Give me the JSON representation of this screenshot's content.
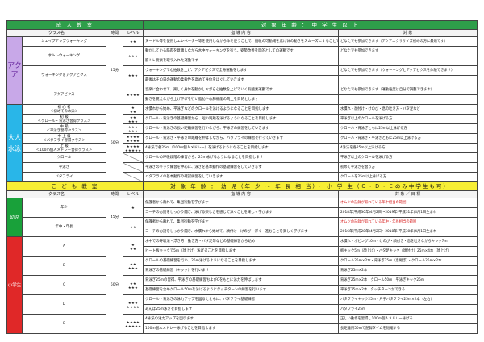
{
  "adult": {
    "title": "成 人 教 室",
    "age_banner": "対 象 年 齢 ： 中 学 生 以 上",
    "headers": {
      "class": "クラス名",
      "time": "時間",
      "level": "レベル",
      "guidance": "指 導 内 容",
      "target": "対 象"
    },
    "aqua": {
      "category": "アクア",
      "time": "45分",
      "rows": [
        {
          "name": "シェイプアップウォーキング",
          "level": "★★",
          "guidance": "ヌードル等を使用しエレベーター等を使用しながら体を使うことで、鋭敏の可動域を広げ体の動きをスムーズにすることでVO2Peakアップを目指すクラス",
          "target": "どなたでも参加できます（アクアエクササイズ初めの方に最適です）"
        },
        {
          "name": "水トレウォーキング",
          "level": "★★★",
          "guidance": "動かしている筋肉を意識しながら水中ウォーキングを行う。姿勢改善を目的としての運動です",
          "target": "どなたでも参加できます"
        },
        {
          "name": "",
          "level": "",
          "guidance": "筋トレ要素を取り入れた運動です",
          "target": ""
        },
        {
          "name": "ウォーキング＆アクアビクス",
          "level": "★★★",
          "guidance": "ウォーキングで心拍数を上げ、アクアビクスで全身運動をします",
          "target": "どなたでも参加できます（ウォーキングとアクアビクスを体験できます）"
        },
        {
          "name": "",
          "level": "",
          "guidance": "最後はその日の運動の柔軟性を高めて身体をほぐしていきます",
          "target": ""
        },
        {
          "name": "アクアビクス",
          "level": "★★★★",
          "guidance": "音楽に合わせて、楽しく身体を動かしながら心拍数を上げていく有酸素運動です",
          "target": "どなたでも参加できます（運動強度は自分で調整できます）"
        },
        {
          "name": "",
          "level": "",
          "guidance": "動きを覚えながら上げ下げを行い脂肪や心肺機能の向上を目的とします",
          "target": ""
        }
      ]
    },
    "swim": {
      "category": "大人水泳",
      "time": "60分",
      "rows": [
        {
          "name": "初 心 者",
          "name2": "＜初めての水泳＞",
          "level": "★\n★★",
          "guidance": "水慣れから始め、平泳ぎなどのクロールを泳げるようになることを目指します",
          "target": "水慣れ・顔付け・けのび・息の吐き方・バタ足など"
        },
        {
          "name": "初 級",
          "name2": "＜クロール・背泳ぎ習得クラス＞",
          "level": "★★\n★★★",
          "guidance": "クロール・背泳ぎの基礎練習から、短い距離を泳げるようになることを目指します",
          "target": "平泳ぎ以上のクロールを泳げる方"
        },
        {
          "name": "中 級",
          "name2": "＜平泳ぎ習得クラス＞",
          "level": "★★★\n★★★",
          "guidance": "クロール・背泳ぎの長い距離練習を行いながら、平泳ぎの練習をしていきます",
          "target": "クロール・背泳ぎともに25m以上泳げる方"
        },
        {
          "name": "中 上 級",
          "name2": "＜バタフライ習得クラス＞",
          "level": "★★★★\n★★★★",
          "guidance": "クロール・背泳ぎ・平泳ぎの距離を伸ばしながら、バタフライの練習を行っていきます",
          "target": "クロール・背泳ぎ・平泳ぎともに25m以上泳げる方"
        },
        {
          "name": "上 級",
          "name2": "＜100m個人メドレー習得クラス＞",
          "level": "★★★★\n★★★★★",
          "guidance": "4泳法で各25m（100m個人メドレー）を泳げるようになることを目指します",
          "target": "4泳法を各25m以上泳げる方"
        },
        {
          "name": "クロール",
          "name2": "",
          "level": "",
          "guidance": "クロールの呼吸段階の練習から、25m泳げるようになることを目指します",
          "target": "平泳ぎ以上のクロールを泳げる方"
        },
        {
          "name": "平泳ぎ",
          "name2": "",
          "level": "",
          "guidance": "平泳ぎのキック練習を中心に、泳ぎを基本動作の基礎練習をしていきます",
          "target": "初めて平泳ぎを習う方"
        },
        {
          "name": "バタフライ",
          "name2": "",
          "level": "",
          "guidance": "バタフライの基本動作の確認練習をしていきます",
          "target": "クロールを25m以上泳げる方"
        }
      ]
    }
  },
  "child": {
    "title": "こ ど も 教 室",
    "age_banner": "対 象 年 齢 ： 幼 児（年 少 〜 年 長 相 当）・ 小 学 生（Ｃ・Ｄ・Ｅのみ中学生も可）",
    "headers": {
      "class": "クラス名",
      "time": "時間",
      "level": "レベル",
      "guidance": "指 導 内 容",
      "target": "対 象 ／ 目 標"
    },
    "yochi": {
      "category": "幼児",
      "time": "45分",
      "rows": [
        {
          "name": "年少",
          "level": "★",
          "guidance": "保護者から離れて、集団行動を学びます",
          "target": "オムツの記録が取れている年中相当の範囲",
          "target_red": true
        },
        {
          "name": "",
          "level": "",
          "guidance": "コーチのお話をしっかり聞き、泳げる楽しさを感じて泳ぐことを楽しく学びます",
          "target": "2018年(平成30年)4月2日〜2019年(平成31年)4月1日生まれ",
          "target_red": false
        },
        {
          "name": "年中・年長",
          "level": "★★",
          "guidance": "保護者から離れて、集団行動を学びます",
          "target": "オムツの記録が取れている年中・年長相当の範囲",
          "target_red": true
        },
        {
          "name": "",
          "level": "",
          "guidance": "コーチのお話をしっかり聞き、水慣れから始めて、顔付け・けのび・浮く・進むことを楽しく学びます",
          "target": "2016年(平成28年)4月2日〜2018年(平成30年)4月1日生まれ",
          "target_red": false
        }
      ]
    },
    "shogaku": {
      "category": "小学生",
      "time": "60分",
      "rows": [
        {
          "name": "A",
          "level": "★\n★★",
          "guidance": "水中での呼吸法・浮き方・動き方・バタ足等などの基礎練習から始め",
          "target": "水慣れ・ボビング10m・けのび・顔付き・息を吐きながらキック7m"
        },
        {
          "name": "",
          "level": "",
          "guidance": "ビート板キックで5m（顔上げ）泳げることを目指します",
          "target": "板キック5m（顔上げ）・バタ足キック（顔付け）25m×4本（顔上げ）"
        },
        {
          "name": "B",
          "level": "★★\n★★★",
          "guidance": "クロールの基礎練習を行い、25m泳げるようになることを目指します",
          "target": "クロール25m×2本・背泳ぎ25m（息継ぎ）・クロール25m×2本"
        },
        {
          "name": "",
          "level": "",
          "guidance": "背泳ぎの基礎練習（キック）を行います",
          "target": "背泳ぎ25m×2本"
        },
        {
          "name": "C",
          "level": "★★\n★★★",
          "guidance": "背泳ぎ25mの習得、平泳ぎの基礎練習およびCをもとに泳力を伸ばします",
          "target": "背泳ぎ25m×2本・クロール50m・平泳ぎキック25m"
        },
        {
          "name": "",
          "level": "",
          "guidance": "基礎練習を含めクロール50mを泳げるようにタッチターンの練習を行います",
          "target": "平泳ぎ25m×2本・タッチターンができる"
        },
        {
          "name": "D",
          "level": "★★★\n★★★★",
          "guidance": "クロール・背泳ぎの泳力アップを図るとともに、バタフライ基礎練習",
          "target": "バタフライキック25m・片手バタフライ25m×2本（左右）"
        },
        {
          "name": "",
          "level": "",
          "guidance": "あんぱ25m泳ぎを目指します",
          "target": "バタフライ25m"
        },
        {
          "name": "E",
          "level": "★★★★\n★★★★★",
          "guidance": "4泳法の泳力アップを図ります",
          "target": "正しい動作を習得し100m個人メドレー泳げる"
        },
        {
          "name": "",
          "level": "",
          "guidance": "100m個人メドレー泳げることを目指します",
          "target": "長距離用50mで記録タイムを短縮する"
        }
      ]
    }
  }
}
